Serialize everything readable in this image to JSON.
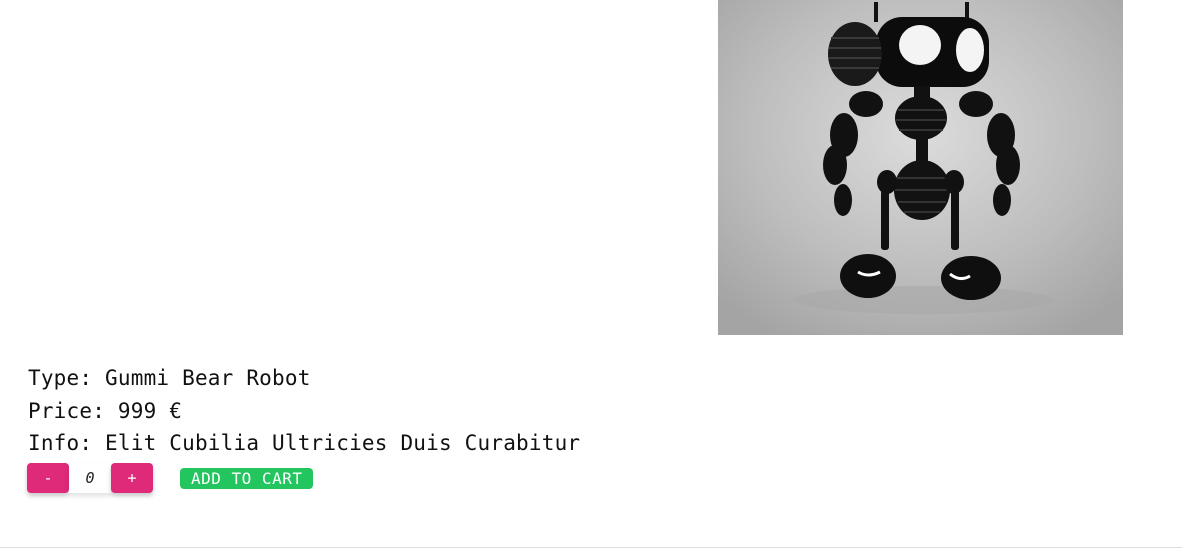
{
  "product": {
    "image_icon": "robot-image",
    "type_line": "Type: Gummi Bear Robot",
    "price_line": "Price: 999 €",
    "info_line": "Info: Elit Cubilia Ultricies Duis Curabitur"
  },
  "cart_controls": {
    "decrement_label": "-",
    "quantity_value": "0",
    "increment_label": "+",
    "add_to_cart_label": "ADD TO CART"
  },
  "colors": {
    "quantity_button": "#de2a78",
    "add_to_cart_button": "#22c55e"
  }
}
